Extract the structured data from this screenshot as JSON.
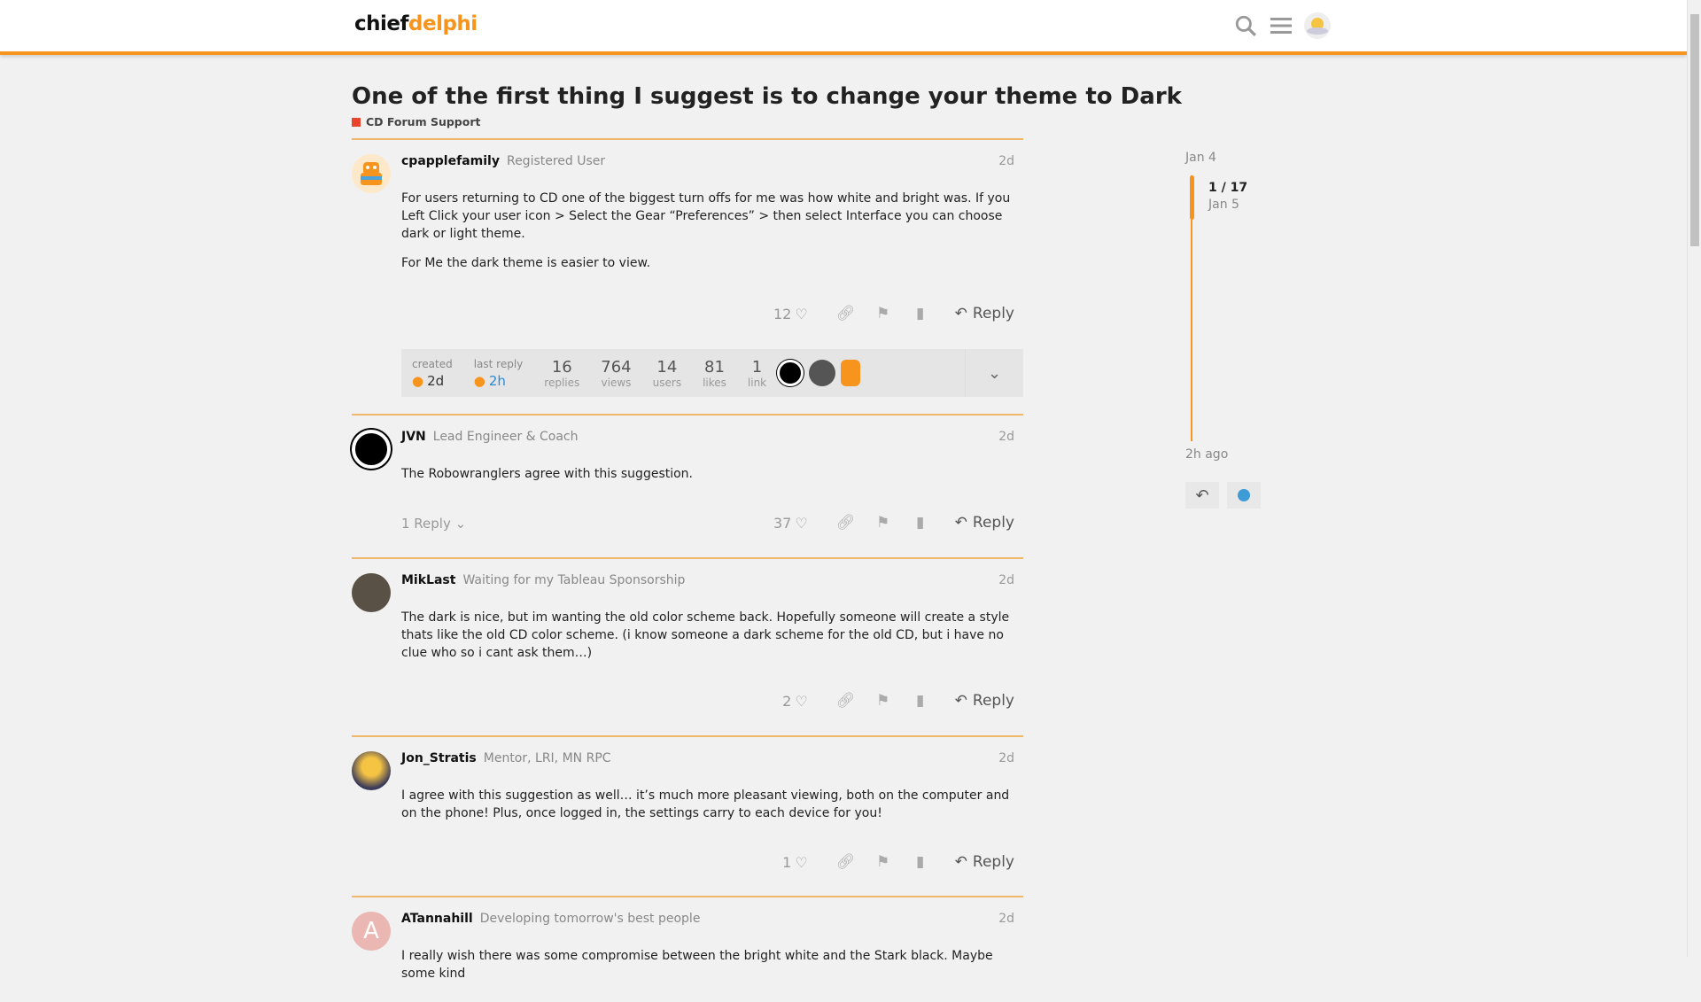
{
  "header": {
    "logo_a": "chief",
    "logo_b": "delphi"
  },
  "topic": {
    "title": "One of the first thing I suggest is to change your theme to Dark",
    "category": "CD Forum Support",
    "category_color": "#e8452c"
  },
  "posts": [
    {
      "username": "cpapplefamily",
      "user_title": "Registered User",
      "date": "2d",
      "paragraphs": [
        "For users returning to CD one of the biggest turn offs for me was how white and bright was. If you Left Click your user icon > Select the Gear “Preferences” > then select Interface you can choose dark or light theme.",
        "For Me the dark theme is easier to view."
      ],
      "likes": "12",
      "reply_label": "Reply"
    },
    {
      "username": "JVN",
      "user_title": "Lead Engineer & Coach",
      "date": "2d",
      "paragraphs": [
        "The Robowranglers agree with this suggestion."
      ],
      "likes": "37",
      "reply_label": "Reply",
      "replies_label": "1 Reply"
    },
    {
      "username": "MikLast",
      "user_title": "Waiting for my Tableau Sponsorship",
      "date": "2d",
      "paragraphs": [
        "The dark is nice, but im wanting the old color scheme back. Hopefully someone will create a style thats like the old CD color scheme. (i know someone a dark scheme for the old CD, but i have no clue who so i cant ask them…)"
      ],
      "likes": "2",
      "reply_label": "Reply"
    },
    {
      "username": "Jon_Stratis",
      "user_title": "Mentor, LRI, MN RPC",
      "date": "2d",
      "paragraphs": [
        "I agree with this suggestion as well… it’s much more pleasant viewing, both on the computer and on the phone! Plus, once logged in, the settings carry to each device for you!"
      ],
      "likes": "1",
      "reply_label": "Reply"
    },
    {
      "username": "ATannahill",
      "user_title": "Developing tomorrow's best people",
      "date": "2d",
      "avatar_letter": "A",
      "paragraphs": [
        "I really wish there was some compromise between the bright white and the Stark black. Maybe some kind"
      ]
    }
  ],
  "topic_map": {
    "created_label": "created",
    "created_value": "2d",
    "last_reply_label": "last reply",
    "last_reply_value": "2h",
    "stats": [
      {
        "num": "16",
        "label": "replies"
      },
      {
        "num": "764",
        "label": "views"
      },
      {
        "num": "14",
        "label": "users"
      },
      {
        "num": "81",
        "label": "likes"
      },
      {
        "num": "1",
        "label": "link"
      }
    ]
  },
  "timeline": {
    "start": "Jan 4",
    "position": "1 / 17",
    "position_date": "Jan 5",
    "end": "2h ago"
  }
}
